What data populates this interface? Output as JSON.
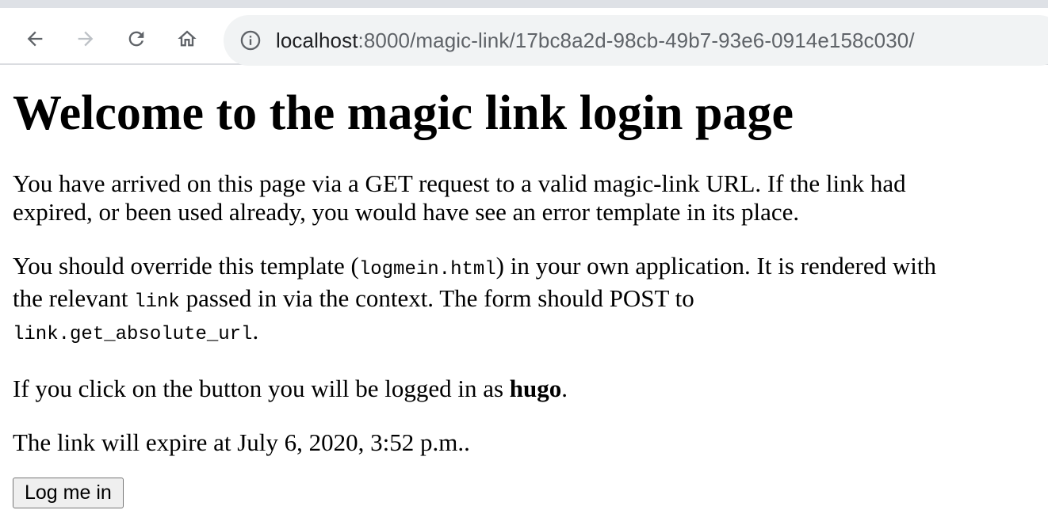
{
  "browser": {
    "url_host": "localhost",
    "url_path": ":8000/magic-link/17bc8a2d-98cb-49b7-93e6-0914e158c030/"
  },
  "page": {
    "heading": "Welcome to the magic link login page",
    "p1": "You have arrived on this page via a GET request to a valid magic-link URL. If the link had expired, or been used already, you would have see an error template in its place.",
    "p2_part1": "You should override this template (",
    "p2_code1": "logmein.html",
    "p2_part2": ") in your own application. It is rendered with the relevant ",
    "p2_code2": "link",
    "p2_part3": " passed in via the context. The form should POST to ",
    "p2_code3": "link.get_absolute_url",
    "p2_part4": ".",
    "p3_part1": "If you click on the button you will be logged in as ",
    "p3_user": "hugo",
    "p3_part2": ".",
    "p4": "The link will expire at July 6, 2020, 3:52 p.m..",
    "login_button_label": "Log me in"
  }
}
